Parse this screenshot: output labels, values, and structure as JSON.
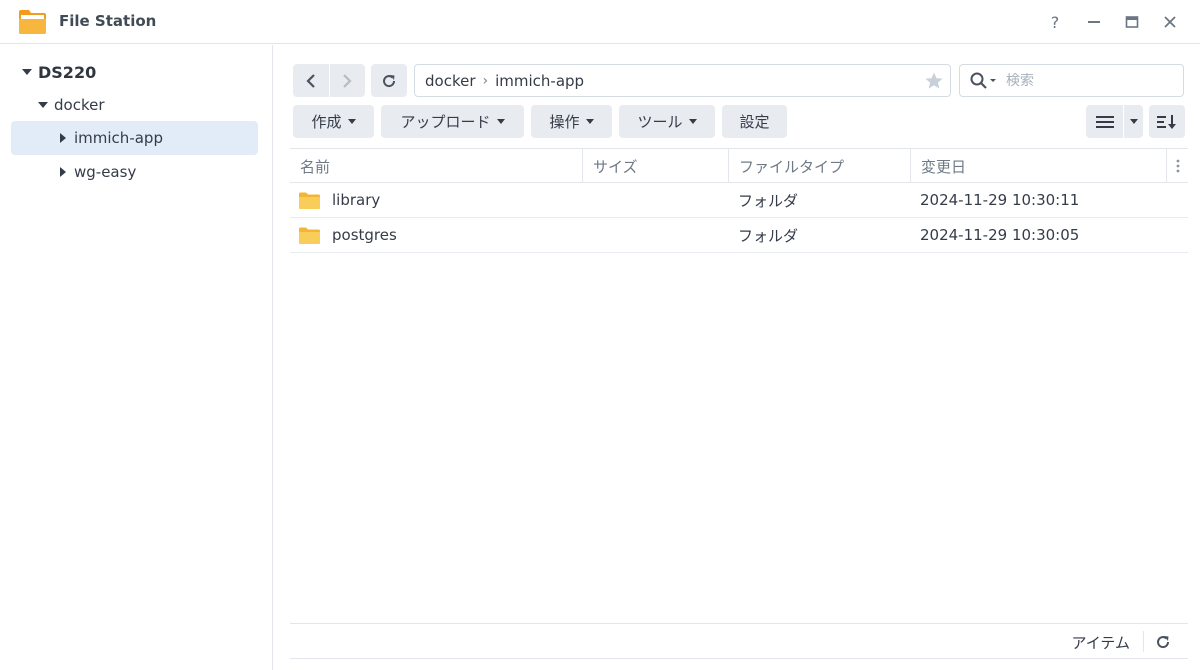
{
  "window": {
    "title": "File Station",
    "controls": [
      "help-icon",
      "minimize-icon",
      "maximize-icon",
      "close-icon"
    ]
  },
  "sidebar": {
    "root": {
      "label": "DS220",
      "expanded": true
    },
    "items": [
      {
        "label": "docker",
        "expanded": true
      },
      {
        "label": "immich-app",
        "selected": true
      },
      {
        "label": "wg-easy"
      }
    ]
  },
  "path": {
    "segments": [
      "docker",
      "immich-app"
    ],
    "separator": "›"
  },
  "search": {
    "placeholder": "検索"
  },
  "toolbar": {
    "create_label": "作成",
    "upload_label": "アップロード",
    "action_label": "操作",
    "tools_label": "ツール",
    "settings_label": "設定"
  },
  "table": {
    "columns": [
      "名前",
      "サイズ",
      "ファイルタイプ",
      "変更日"
    ],
    "rows": [
      {
        "name": "library",
        "size": "",
        "type": "フォルダ",
        "modified": "2024-11-29 10:30:11"
      },
      {
        "name": "postgres",
        "size": "",
        "type": "フォルダ",
        "modified": "2024-11-29 10:30:05"
      }
    ]
  },
  "footer": {
    "label": "アイテム"
  },
  "colors": {
    "accent_selected": "#e1ecf8",
    "button_bg": "#e8ecf1",
    "folder": "#f7c24a",
    "border": "#e3e7ec"
  }
}
